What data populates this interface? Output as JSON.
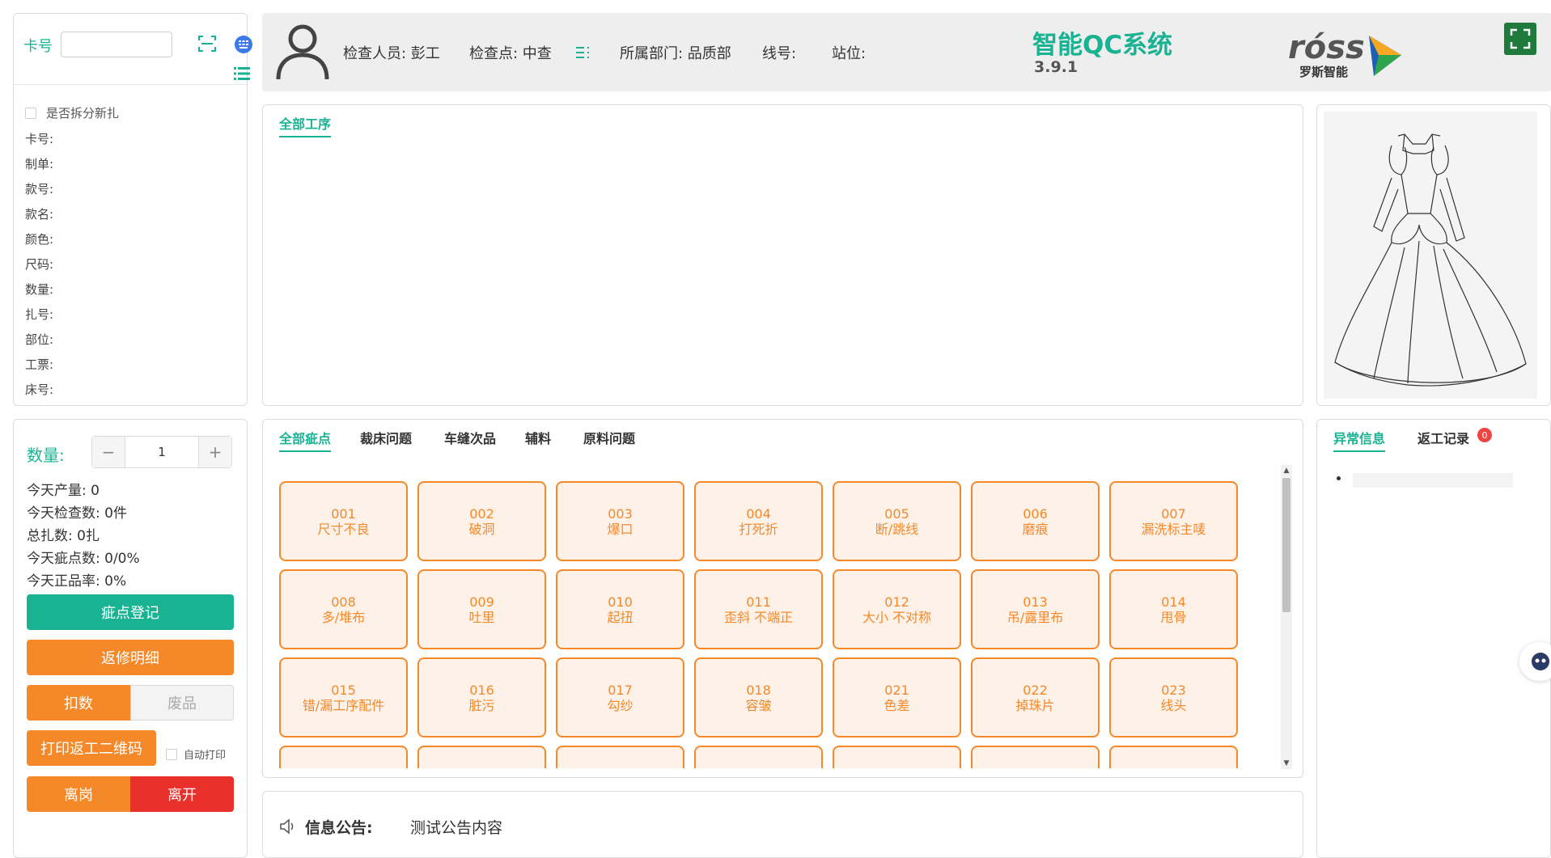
{
  "card": {
    "label": "卡号",
    "input_value": "",
    "icons": [
      "scan-icon",
      "globe-icon",
      "list-icon"
    ]
  },
  "split_checkbox": {
    "label": "是否拆分新扎",
    "checked": false
  },
  "info_fields": [
    "卡号:",
    "制单:",
    "款号:",
    "款名:",
    "颜色:",
    "尺码:",
    "数量:",
    "扎号:",
    "部位:",
    "工票:",
    "床号:"
  ],
  "quantity": {
    "label": "数量:",
    "value": "1",
    "minus": "−",
    "plus": "+"
  },
  "stats": [
    "今天产量: 0",
    "今天检查数: 0件",
    "总扎数: 0扎",
    "今天疵点数: 0/0%",
    "今天正品率: 0%"
  ],
  "buttons": {
    "register": "疵点登记",
    "repair_detail": "返修明细",
    "deduct": "扣数",
    "waste": "废品",
    "print_qr": "打印返工二维码",
    "auto_print": "自动打印",
    "leave_post": "离岗",
    "exit": "离开"
  },
  "header": {
    "inspector": "检查人员: 彭工",
    "checkpoint": "检查点: 中查",
    "department": "所属部门: 品质部",
    "line": "线号:",
    "station": "站位:",
    "app_title": "智能QC系统",
    "version": "3.9.1",
    "logo_text": "róss",
    "logo_sub": "罗斯智能"
  },
  "process_tabs": [
    "全部工序"
  ],
  "defect_tabs": [
    "全部疵点",
    "裁床问题",
    "车缝次品",
    "辅料",
    "原料问题"
  ],
  "defects": [
    {
      "code": "001",
      "name": "尺寸不良"
    },
    {
      "code": "002",
      "name": "破洞"
    },
    {
      "code": "003",
      "name": "爆口"
    },
    {
      "code": "004",
      "name": "打死折"
    },
    {
      "code": "005",
      "name": "断/跳线"
    },
    {
      "code": "006",
      "name": "磨痕"
    },
    {
      "code": "007",
      "name": "漏洗标主唛"
    },
    {
      "code": "008",
      "name": "多/堆布"
    },
    {
      "code": "009",
      "name": "吐里"
    },
    {
      "code": "010",
      "name": "起扭"
    },
    {
      "code": "011",
      "name": "歪斜 不端正"
    },
    {
      "code": "012",
      "name": "大小 不对称"
    },
    {
      "code": "013",
      "name": "吊/露里布"
    },
    {
      "code": "014",
      "name": "甩骨"
    },
    {
      "code": "015",
      "name": "错/漏工序配件"
    },
    {
      "code": "016",
      "name": "脏污"
    },
    {
      "code": "017",
      "name": "勾纱"
    },
    {
      "code": "018",
      "name": "容皱"
    },
    {
      "code": "021",
      "name": "色差"
    },
    {
      "code": "022",
      "name": "掉珠片"
    },
    {
      "code": "023",
      "name": "线头"
    },
    {
      "code": "",
      "name": ""
    },
    {
      "code": "",
      "name": ""
    },
    {
      "code": "",
      "name": ""
    },
    {
      "code": "",
      "name": ""
    },
    {
      "code": "",
      "name": ""
    },
    {
      "code": "",
      "name": ""
    },
    {
      "code": "",
      "name": ""
    }
  ],
  "notice": {
    "title": "信息公告:",
    "text": "测试公告内容"
  },
  "right_tabs": {
    "abnormal": "异常信息",
    "rework": "返工记录",
    "rework_badge": "0"
  },
  "colors": {
    "accent": "#19b393",
    "orange": "#f5892a",
    "red": "#e9302a",
    "defect_bg": "#fdf1e8"
  }
}
